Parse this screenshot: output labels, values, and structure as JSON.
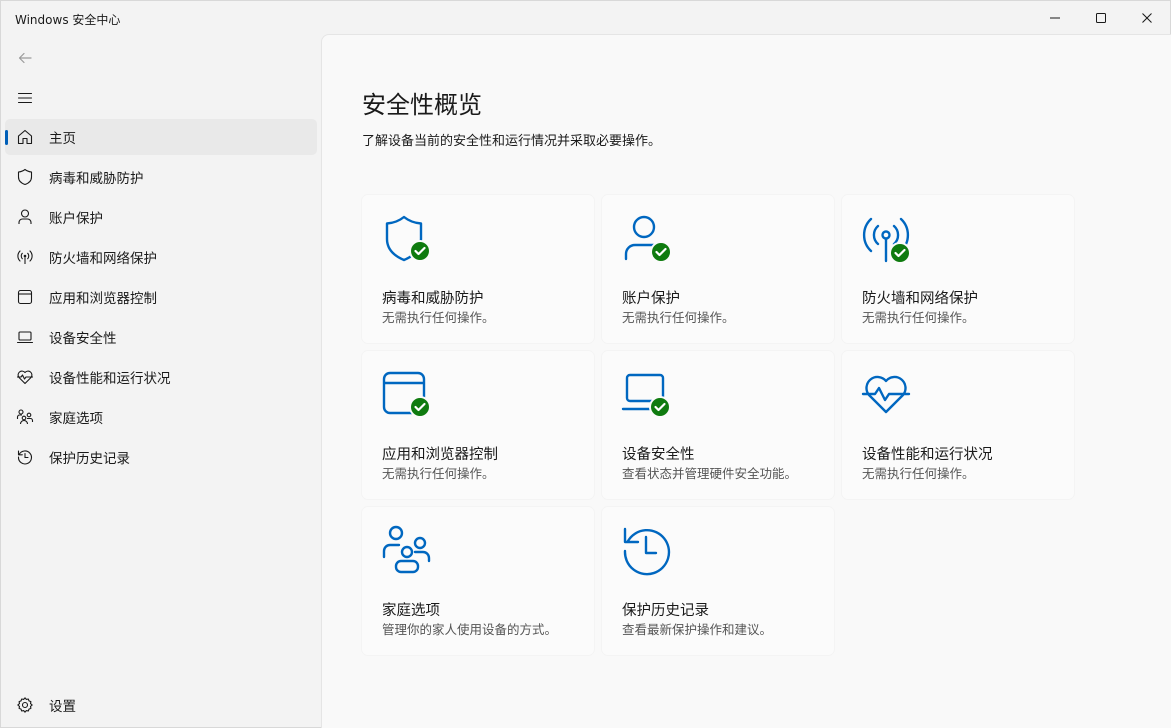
{
  "window": {
    "title": "Windows 安全中心"
  },
  "sidebar": {
    "items": [
      {
        "label": "主页",
        "icon": "home-icon",
        "active": true
      },
      {
        "label": "病毒和威胁防护",
        "icon": "shield-icon"
      },
      {
        "label": "账户保护",
        "icon": "person-icon"
      },
      {
        "label": "防火墙和网络保护",
        "icon": "antenna-icon"
      },
      {
        "label": "应用和浏览器控制",
        "icon": "browser-window-icon"
      },
      {
        "label": "设备安全性",
        "icon": "laptop-icon"
      },
      {
        "label": "设备性能和运行状况",
        "icon": "heart-pulse-icon"
      },
      {
        "label": "家庭选项",
        "icon": "family-icon"
      },
      {
        "label": "保护历史记录",
        "icon": "history-icon"
      }
    ],
    "settings_label": "设置"
  },
  "main": {
    "title": "安全性概览",
    "subtitle": "了解设备当前的安全性和运行情况并采取必要操作。",
    "cards": [
      {
        "title": "病毒和威胁防护",
        "desc": "无需执行任何操作。",
        "icon": "shield-icon",
        "status": "ok"
      },
      {
        "title": "账户保护",
        "desc": "无需执行任何操作。",
        "icon": "person-icon",
        "status": "ok"
      },
      {
        "title": "防火墙和网络保护",
        "desc": "无需执行任何操作。",
        "icon": "antenna-icon",
        "status": "ok"
      },
      {
        "title": "应用和浏览器控制",
        "desc": "无需执行任何操作。",
        "icon": "browser-window-icon",
        "status": "ok"
      },
      {
        "title": "设备安全性",
        "desc": "查看状态并管理硬件安全功能。",
        "icon": "laptop-icon",
        "status": "ok"
      },
      {
        "title": "设备性能和运行状况",
        "desc": "无需执行任何操作。",
        "icon": "heart-pulse-icon",
        "status": "none"
      },
      {
        "title": "家庭选项",
        "desc": "管理你的家人使用设备的方式。",
        "icon": "family-icon",
        "status": "none"
      },
      {
        "title": "保护历史记录",
        "desc": "查看最新保护操作和建议。",
        "icon": "history-icon",
        "status": "none"
      }
    ]
  },
  "colors": {
    "accent": "#005fb8",
    "icon_blue": "#0067c0",
    "ok_green": "#0f7b0f"
  }
}
